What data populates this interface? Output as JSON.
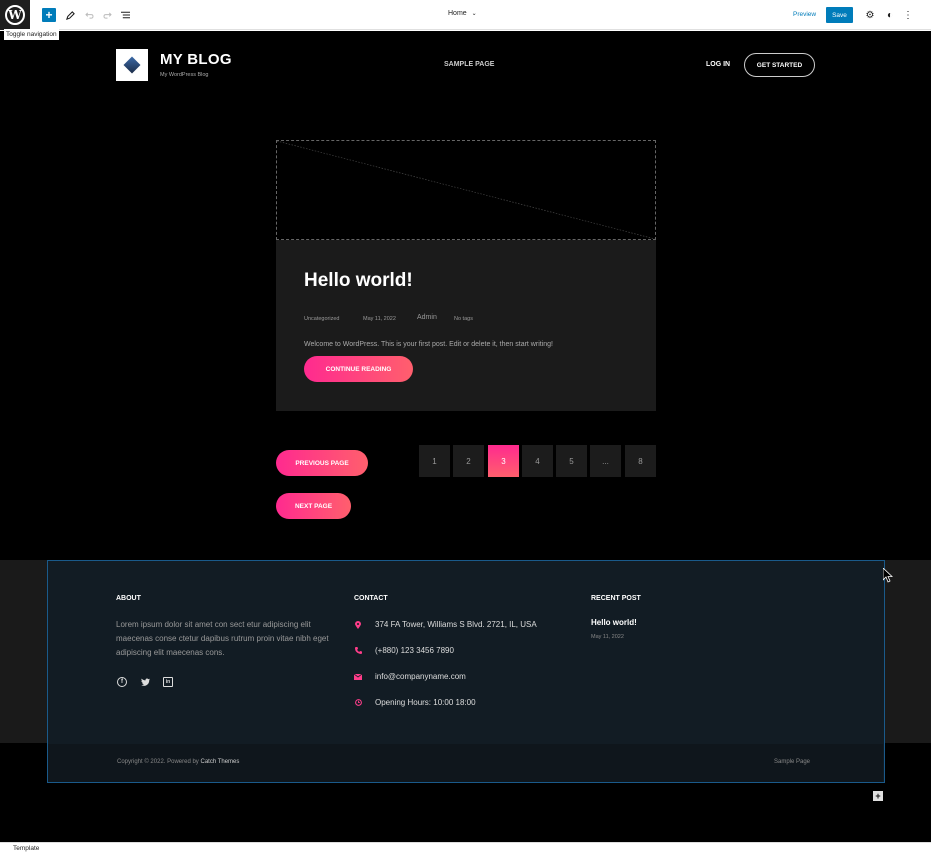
{
  "toolbar": {
    "tooltip": "Toggle navigation",
    "add_icon": "plus-icon",
    "tools_icon": "pencil-icon",
    "undo_icon": "undo-icon",
    "redo_icon": "redo-icon",
    "list_view_icon": "list-view-icon",
    "document_title": "Home",
    "preview_label": "Preview",
    "save_label": "Save",
    "settings_icon": "gear-icon",
    "styles_icon": "half-circle-icon",
    "options_icon": "vertical-ellipsis-icon"
  },
  "header": {
    "site_title": "MY BLOG",
    "tagline": "My WordPress Blog",
    "nav_item": "SAMPLE PAGE",
    "login_label": "LOG IN",
    "cta_label": "GET STARTED"
  },
  "post": {
    "title": "Hello world!",
    "category": "Uncategorized",
    "date": "May 11, 2022",
    "author": "Admin",
    "tags": "No tags",
    "excerpt": "Welcome to WordPress. This is your first post. Edit or delete it, then start writing!",
    "read_more": "CONTINUE READING"
  },
  "pagination": {
    "previous_label": "PREVIOUS PAGE",
    "next_label": "NEXT PAGE",
    "pages": [
      "1",
      "2",
      "3",
      "4",
      "5",
      "...",
      "8"
    ],
    "current": "3"
  },
  "footer": {
    "about_title": "ABOUT",
    "about_text": "Lorem ipsum dolor sit amet con sect etur adipiscing elit maecenas conse ctetur dapibus rutrum proin vitae nibh eget adipiscing elit maecenas cons.",
    "contact_title": "CONTACT",
    "address": "374 FA Tower, Williams S Blvd. 2721, IL, USA",
    "phone": "(+880) 123 3456 7890",
    "email": "info@companyname.com",
    "hours": "Opening Hours: 10:00 18:00",
    "recent_title": "RECENT POST",
    "recent_post_title": "Hello world!",
    "recent_post_date": "May 11, 2022",
    "copyright_prefix": "Copyright © 2022. Powered by",
    "copyright_link": "Catch Themes",
    "bottom_link": "Sample Page"
  },
  "colors": {
    "accent_pink": "#ff2a8f",
    "accent_coral": "#ff5f6d",
    "editor_blue": "#007cba"
  },
  "status": {
    "label": "Template"
  }
}
